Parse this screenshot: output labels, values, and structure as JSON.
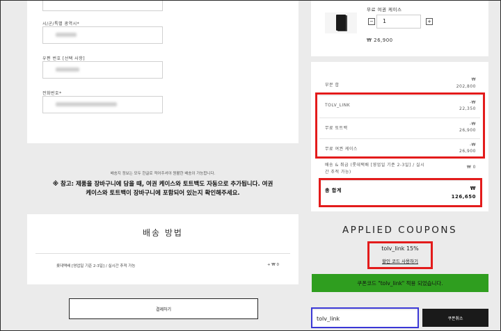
{
  "form": {
    "city_label": "시/군/특별 광역시*",
    "zip_label": "우편 번호 [선택 사항]",
    "phone_label": "전화번호*"
  },
  "notice": {
    "small": "배송지 정보는 모두 한글로 적어주셔야 원활한 배송이 가능합니다.",
    "bold_line1": "※ 참고: 제품을 장바구니에 담을 때, 여권 케이스와 토트백도 자동으로 추가됩니다. 여권",
    "bold_line2": "케이스와 토트백이 장바구니에 포함되어 있는지 확인해주세요."
  },
  "shipping": {
    "title": "배송 방법",
    "option": "롯데택배 [영업일 기준 2-3일] / 실시간 추적 가능",
    "price": "+ ₩ 0"
  },
  "pay_button": "결제하기",
  "item": {
    "name": "무료 여권 케이스",
    "quantity": "1",
    "minus": "−",
    "plus": "+",
    "price": "₩ 26,900",
    "icon": "passport-case-thumbnail"
  },
  "summary": {
    "subtotal_label": "부분 합",
    "subtotal_currency": "₩",
    "subtotal_value": "202,800",
    "discounts": [
      {
        "label": "TOLV_LINK",
        "currency": "-₩",
        "value": "22,350"
      },
      {
        "label": "무료 토트백",
        "currency": "-₩",
        "value": "26,900"
      },
      {
        "label": "무료 여권 케이스",
        "currency": "-₩",
        "value": "26,900"
      }
    ],
    "shipping_label_1": "배송 & 취급 (롯데택배 [영업일 기준 2-3일] / 실시",
    "shipping_label_2": "간 추적 가능)",
    "shipping_value": "₩ 0",
    "total_label": "총 합계",
    "total_currency": "₩",
    "total_value": "126,650"
  },
  "coupons": {
    "title": "APPLIED COUPONS",
    "code_line": "tolv_link 15%",
    "remove_link": "할인 코드 사용하기",
    "success_message": "쿠폰코드 \"tolv_link\" 적용 되었습니다.",
    "input_value": "tolv_link",
    "apply_button": "쿠폰취소"
  },
  "colors": {
    "highlight_red": "#e31b1b",
    "highlight_blue": "#3a37d6",
    "success_green": "#2f9e1f",
    "button_dark": "#1a1a1a"
  }
}
